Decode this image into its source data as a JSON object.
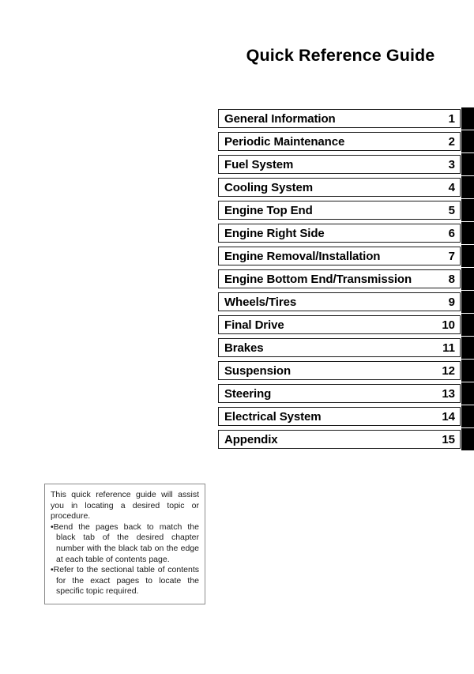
{
  "document": {
    "title": "Quick Reference Guide"
  },
  "chapter_index": {
    "rows": [
      {
        "label": "General Information",
        "number": "1"
      },
      {
        "label": "Periodic Maintenance",
        "number": "2"
      },
      {
        "label": "Fuel System",
        "number": "3"
      },
      {
        "label": "Cooling System",
        "number": "4"
      },
      {
        "label": "Engine Top End",
        "number": "5"
      },
      {
        "label": "Engine Right Side",
        "number": "6"
      },
      {
        "label": "Engine Removal/Installation",
        "number": "7"
      },
      {
        "label": "Engine Bottom End/Transmission",
        "number": "8"
      },
      {
        "label": "Wheels/Tires",
        "number": "9"
      },
      {
        "label": "Final Drive",
        "number": "10"
      },
      {
        "label": "Brakes",
        "number": "11"
      },
      {
        "label": "Suspension",
        "number": "12"
      },
      {
        "label": "Steering",
        "number": "13"
      },
      {
        "label": "Electrical System",
        "number": "14"
      },
      {
        "label": "Appendix",
        "number": "15"
      }
    ]
  },
  "note": {
    "paragraph": "This quick reference guide will assist you in locating a desired topic or procedure.",
    "bullets": [
      "•Bend the pages back to match the black tab of the desired chapter number with the black tab on the edge at each table of contents page.",
      "•Refer to the sectional table of contents for the exact pages to locate the specific topic required."
    ]
  },
  "colors": {
    "page_background": "#ffffff",
    "text": "#000000",
    "tab_black": "#000000",
    "box_border": "#1a1a1a",
    "note_border": "#8c8c8c"
  }
}
